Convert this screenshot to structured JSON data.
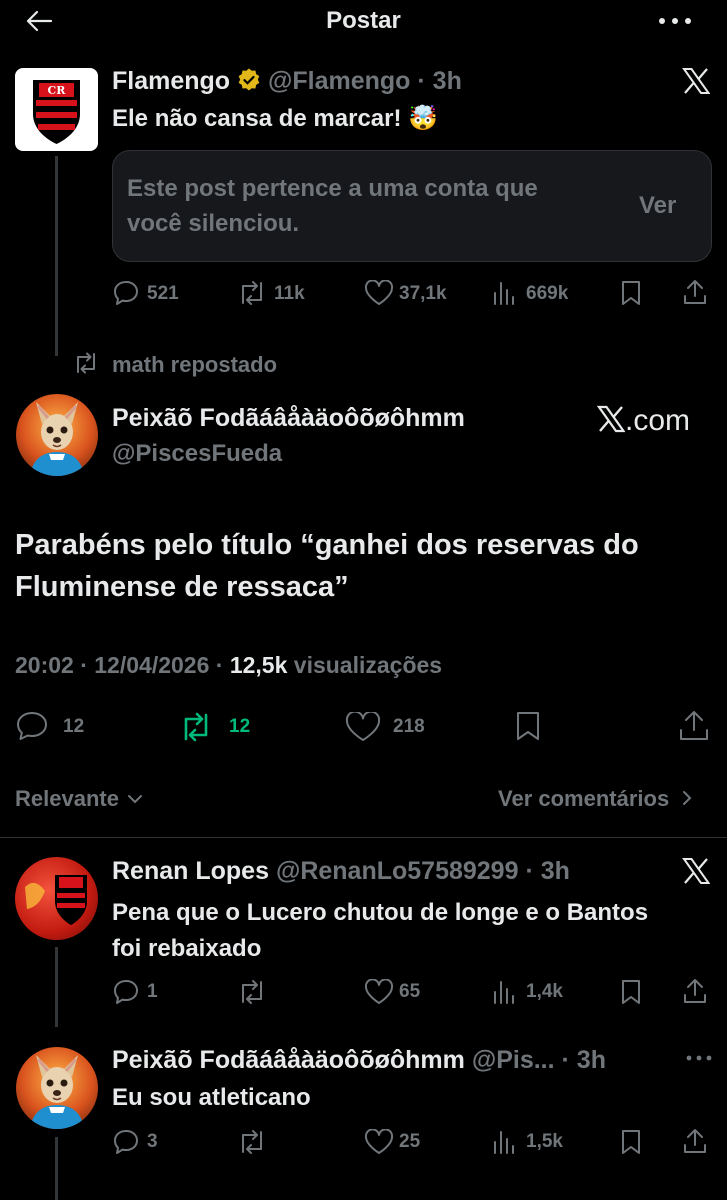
{
  "header": {
    "title": "Postar"
  },
  "quoted_post": {
    "name": "Flamengo",
    "handle": "@Flamengo",
    "time": "· 3h",
    "text": "Ele não cansa de marcar! 🤯",
    "muted_notice": "Este post pertence a uma conta que você silenciou.",
    "muted_button": "Ver",
    "stats": {
      "replies": "521",
      "reposts": "11k",
      "likes": "37,1k",
      "views": "669k"
    }
  },
  "repost_label": "math repostado",
  "main_post": {
    "name": "Peixãõ Fodãáâåàäoôõøôhmm",
    "handle": "@PiscesFueda",
    "source_label": ".com",
    "text": "Parabéns pelo título “ganhei dos reservas do Fluminense de ressaca”",
    "time": "20:02 · 12/04/2026 · ",
    "views_count": "12,5k",
    "views_label": " visualizações",
    "stats": {
      "replies": "12",
      "reposts": "12",
      "likes": "218"
    }
  },
  "sort_bar": {
    "label": "Relevante",
    "comments_link": "Ver comentários"
  },
  "replies": [
    {
      "name": "Renan Lopes",
      "handle": "@RenanLo57589299",
      "time": "· 3h",
      "text": "Pena que o Lucero chutou de longe e o Bantos foi rebaixado",
      "stats": {
        "replies": "1",
        "reposts": "",
        "likes": "65",
        "views": "1,4k"
      }
    },
    {
      "name": "Peixãõ Fodãáâåàäoôõøôhmm",
      "handle": "@Pis...",
      "time": "· 3h",
      "text": "Eu sou atleticano",
      "stats": {
        "replies": "3",
        "reposts": "",
        "likes": "25",
        "views": "1,5k"
      }
    }
  ],
  "colors": {
    "background": "#000000",
    "text": "#e7e9ea",
    "secondary": "#71767b",
    "repost_active": "#00ba7c",
    "verified_gold": "#e2b719",
    "card_bg": "#16181c"
  }
}
